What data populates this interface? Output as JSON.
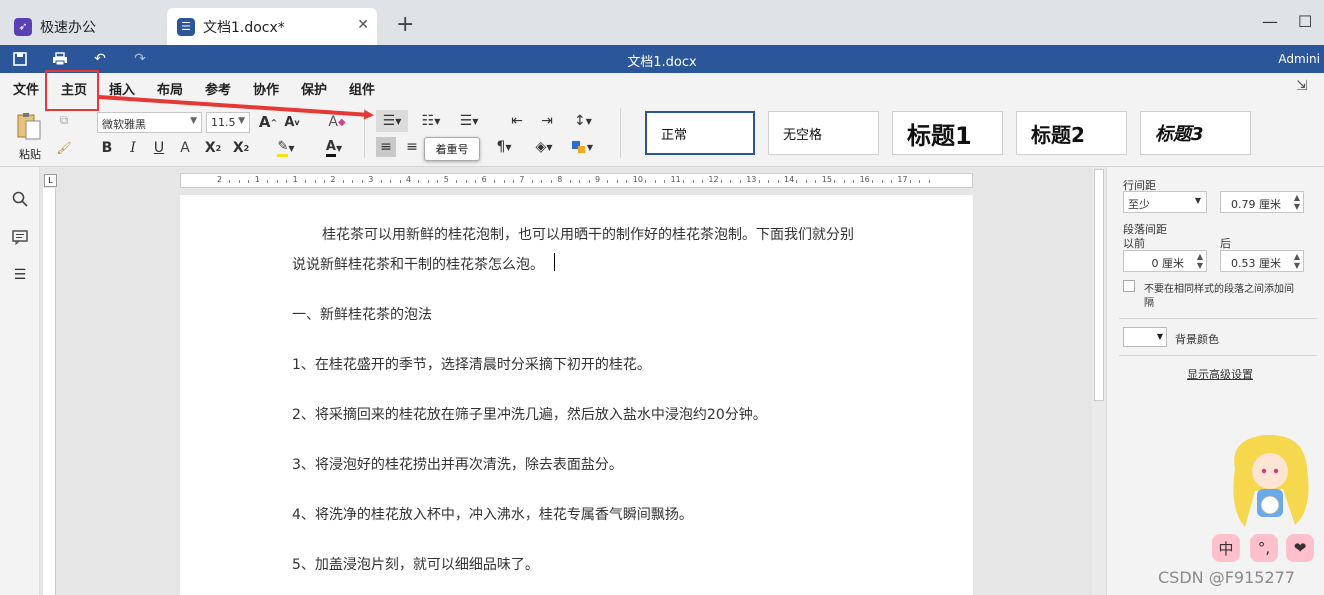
{
  "tabs": {
    "app_label": "极速办公",
    "doc_label": "文档1.docx*",
    "close_glyph": "✕",
    "new_tab_glyph": "+"
  },
  "window": {
    "minimize_glyph": "—",
    "maximize_glyph": "☐"
  },
  "titlebar": {
    "doc_title": "文档1.docx",
    "user": "Admini"
  },
  "menu": [
    "文件",
    "主页",
    "插入",
    "布局",
    "参考",
    "协作",
    "保护",
    "组件"
  ],
  "active_menu_index": 1,
  "ribbon": {
    "paste_label": "粘贴",
    "font_name": "微软雅黑",
    "font_size": "11.5",
    "tooltip": "着重号",
    "styles": [
      "正常",
      "无空格",
      "标题1",
      "标题2",
      "标题3"
    ]
  },
  "document": {
    "paragraphs": [
      "桂花茶可以用新鲜的桂花泡制，也可以用晒干的制作好的桂花茶泡制。下面我们就分别",
      "说说新鲜桂花茶和干制的桂花茶怎么泡。",
      "一、新鲜桂花茶的泡法",
      "1、在桂花盛开的季节，选择清晨时分采摘下初开的桂花。",
      "2、将采摘回来的桂花放在筛子里冲洗几遍，然后放入盐水中浸泡约20分钟。",
      "3、将浸泡好的桂花捞出并再次清洗，除去表面盐分。",
      "4、将洗净的桂花放入杯中，冲入沸水，桂花专属香气瞬间飘扬。",
      "5、加盖浸泡片刻，就可以细细品味了。"
    ]
  },
  "ruler_labels": [
    "2",
    "1",
    "1",
    "2",
    "3",
    "4",
    "5",
    "6",
    "7",
    "8",
    "9",
    "10",
    "11",
    "12",
    "13",
    "14",
    "15",
    "16",
    "17"
  ],
  "right_panel": {
    "line_spacing_label": "行间距",
    "line_spacing_mode": "至少",
    "line_spacing_value": "0.79 厘米",
    "para_spacing_label": "段落间距",
    "before_label": "以前",
    "after_label": "后",
    "before_value": "0 厘米",
    "after_value": "0.53 厘米",
    "no_space_checkbox": "不要在相同样式的段落之间添加间",
    "no_space_checkbox_wrap": "隔",
    "bg_color_label": "背景颜色",
    "advanced_link": "显示高级设置"
  },
  "ime": [
    "中",
    "°,",
    "❤"
  ],
  "watermark": "CSDN @F915277",
  "colors": {
    "titlebar": "#2b579a",
    "annotation_red": "#e53935",
    "ime_pink": "#ffc0cb"
  }
}
